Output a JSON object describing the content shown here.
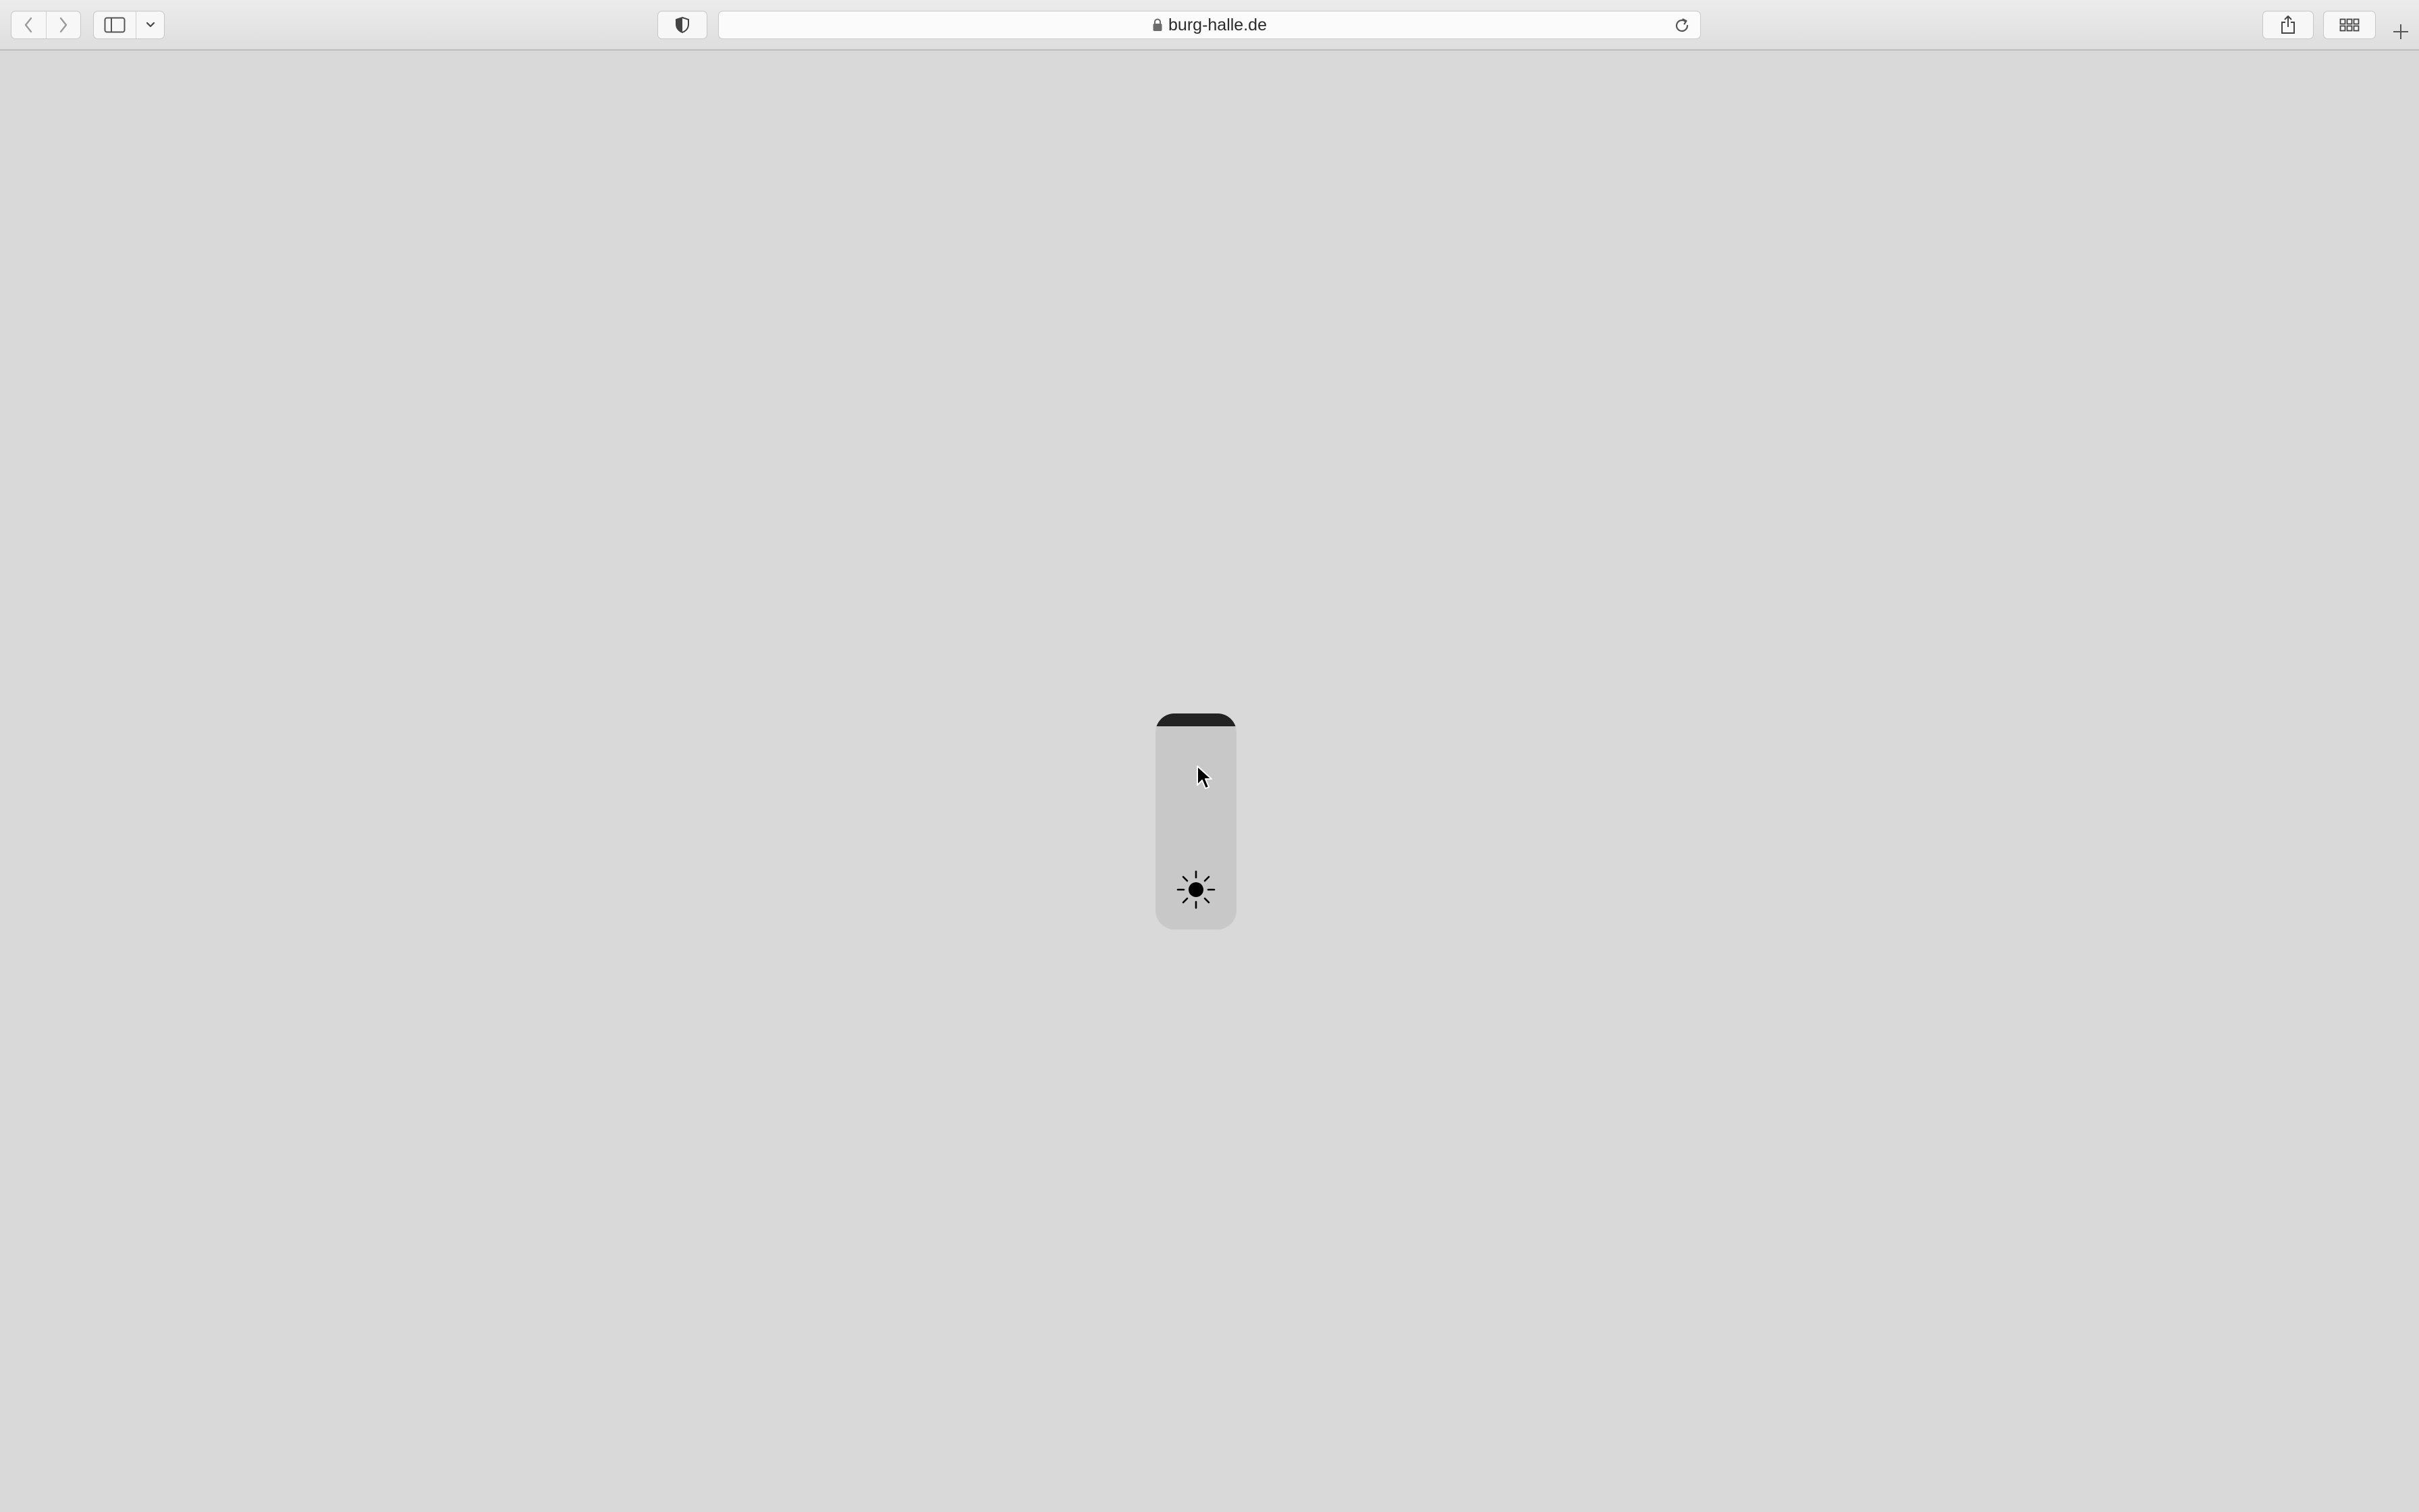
{
  "browser": {
    "address_bar": {
      "url": "burg-halle.de",
      "secure": true
    },
    "icons": {
      "back": "chevron-left-icon",
      "forward": "chevron-right-icon",
      "sidebar": "sidebar-icon",
      "sidebar_menu": "chevron-down-icon",
      "privacy": "shield-icon",
      "lock": "lock-icon",
      "reload": "reload-icon",
      "share": "share-icon",
      "tab_overview": "tab-overview-icon",
      "new_tab": "plus-icon"
    }
  },
  "page": {
    "background_color": "#d9d9d9",
    "brightness_slider": {
      "level": 0.06,
      "track_color": "#c8c8c8",
      "fill_color": "#232323",
      "icon": "sun-icon"
    }
  }
}
